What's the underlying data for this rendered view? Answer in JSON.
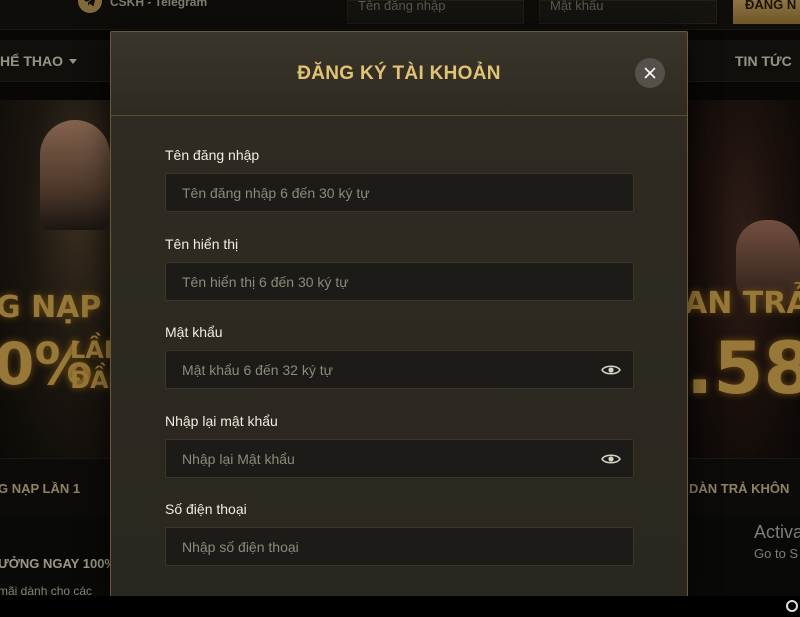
{
  "topbar": {
    "support_label": "CSKH - Telegram",
    "username_placeholder": "Tên đăng nhập",
    "password_placeholder": "Mật khẩu",
    "login_button": "ĐĂNG N"
  },
  "nav": {
    "left_item": "HỂ THAO",
    "right_item": "TIN TỨC"
  },
  "banners": {
    "left": {
      "line1": "G NẠP",
      "line2": "0%",
      "line3": "LẦN",
      "line4": "ĐẦU"
    },
    "right": {
      "line1": "AN TRẢ",
      "line2": ".58"
    }
  },
  "strips": {
    "left_title": "G NẠP LẦN 1",
    "right_title": "DÀN TRẢ KHÔN"
  },
  "promo": {
    "headline": "ƯỞNG NGAY 100%",
    "subtext": "mãi dành cho các"
  },
  "windows_notice": {
    "title": "Activa",
    "subtitle": "Go to S"
  },
  "modal": {
    "title": "ĐĂNG KÝ TÀI KHOẢN",
    "fields": [
      {
        "label": "Tên đăng nhập",
        "placeholder": "Tên đăng nhập 6 đến 30 ký tự"
      },
      {
        "label": "Tên hiển thị",
        "placeholder": "Tên hiển thị 6 đến 30 ký tự"
      },
      {
        "label": "Mật khẩu",
        "placeholder": "Mật khẩu 6 đến 32 ký tự"
      },
      {
        "label": "Nhập lại mật khẩu",
        "placeholder": "Nhập lại Mật khẩu"
      },
      {
        "label": "Số điện thoại",
        "placeholder": "Nhập số điện thoại"
      }
    ]
  },
  "icons": {
    "telegram": "telegram-icon",
    "close": "close-icon",
    "password_visibility": "eye-icon"
  },
  "colors": {
    "accent_gold": "#e2c274",
    "modal_bg": "#2f2b22",
    "field_bg": "#1c1b17"
  }
}
